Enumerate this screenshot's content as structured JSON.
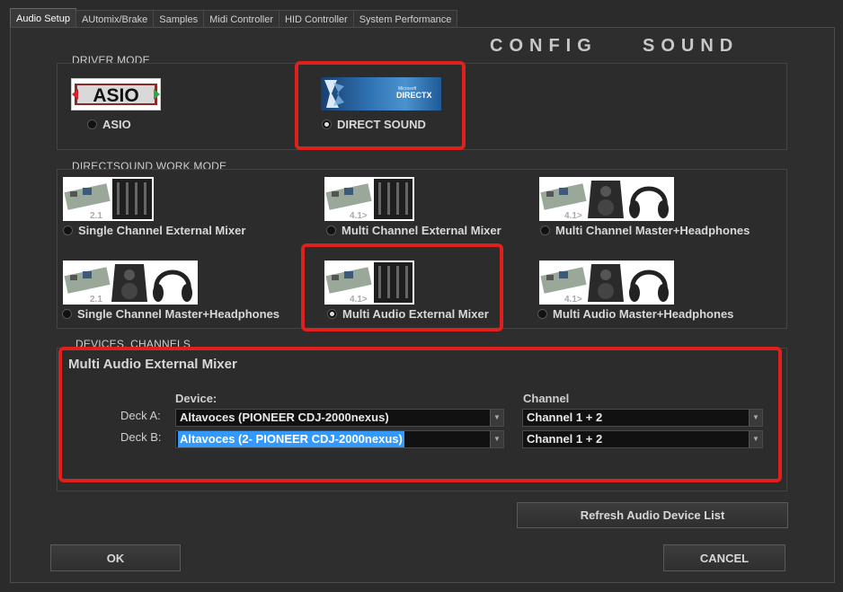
{
  "tabs": [
    {
      "label": "Audio Setup",
      "active": true
    },
    {
      "label": "AUtomix/Brake"
    },
    {
      "label": "Samples"
    },
    {
      "label": "Midi Controller"
    },
    {
      "label": "HID Controller"
    },
    {
      "label": "System Performance"
    }
  ],
  "title": "CONFIG    SOUND",
  "driver_mode": {
    "label": "DRIVER MODE",
    "asio_logo": "ASIO",
    "asio_label": "ASIO",
    "directx_logo": "DIRECTX",
    "directx_brand": "Microsoft",
    "direct_sound_label": "DIRECT SOUND",
    "selected": "DIRECT SOUND"
  },
  "work_mode": {
    "label": "DIRECTSOUND WORK MODE",
    "options": [
      {
        "label": "Single Channel External Mixer",
        "badge": "2.1"
      },
      {
        "label": "Multi Channel External Mixer",
        "badge": "4.1>"
      },
      {
        "label": "Multi Channel Master+Headphones",
        "badge": "4.1>"
      },
      {
        "label": "Single Channel Master+Headphones",
        "badge": "2.1"
      },
      {
        "label": "Multi Audio External Mixer",
        "badge": "4.1>",
        "selected": true
      },
      {
        "label": "Multi Audio Master+Headphones",
        "badge": "4.1>"
      }
    ]
  },
  "devices": {
    "label": "DEVICES, CHANNELS",
    "title": "Multi Audio External Mixer",
    "device_header": "Device:",
    "channel_header": "Channel",
    "deck_a_label": "Deck A:",
    "deck_b_label": "Deck B:",
    "deck_a_device": "Altavoces (PIONEER CDJ-2000nexus)",
    "deck_b_device": "Altavoces (2- PIONEER CDJ-2000nexus)",
    "deck_a_channel": "Channel 1 + 2",
    "deck_b_channel": "Channel 1 + 2"
  },
  "buttons": {
    "refresh": "Refresh Audio Device List",
    "ok": "OK",
    "cancel": "CANCEL"
  },
  "colors": {
    "highlight": "#e0201c",
    "selection": "#3399ff",
    "background": "#2b2b2b"
  }
}
